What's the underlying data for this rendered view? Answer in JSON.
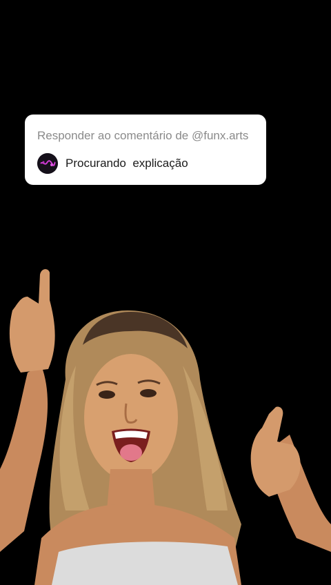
{
  "reply_card": {
    "header": "Responder ao comentário de @funx.arts",
    "comment": "Procurando  explicação",
    "avatar_icon": "funx-arts-avatar-icon"
  },
  "scene": {
    "background_color": "#000000",
    "subject": "woman-dancing-image"
  }
}
